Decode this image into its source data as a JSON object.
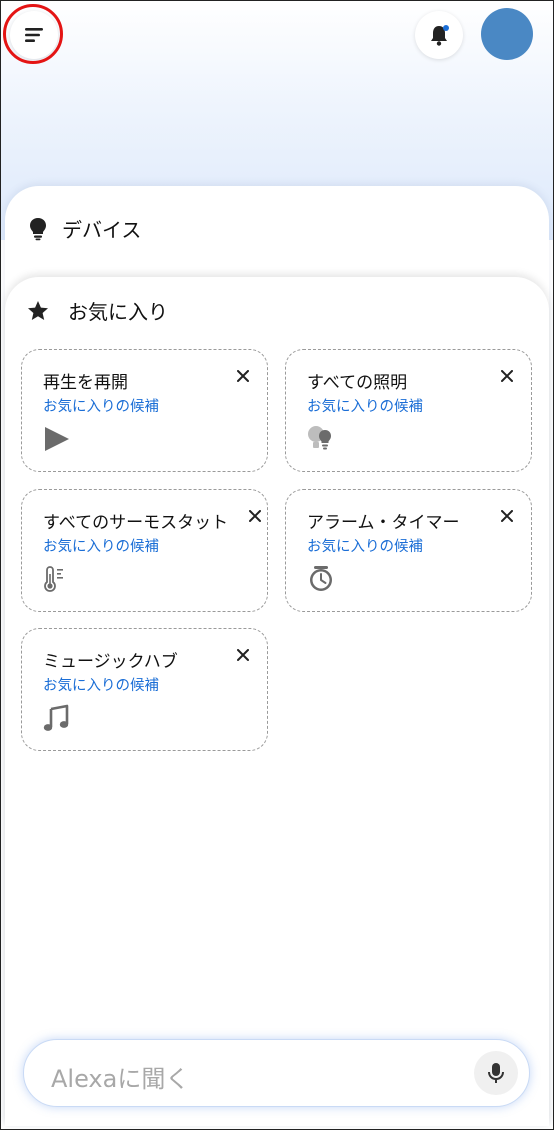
{
  "header": {
    "menu_icon": "menu-icon",
    "bell_icon": "bell-icon",
    "bell_dot_color": "#1b6ed6",
    "avatar_color": "#4a88c4"
  },
  "devices": {
    "label": "デバイス",
    "icon": "lightbulb-icon"
  },
  "favorites": {
    "label": "お気に入り",
    "icon": "star-icon",
    "cards": [
      {
        "title": "再生を再開",
        "subtitle": "お気に入りの候補",
        "icon": "play-icon"
      },
      {
        "title": "すべての照明",
        "subtitle": "お気に入りの候補",
        "icon": "lights-icon"
      },
      {
        "title": "すべてのサーモスタット",
        "subtitle": "お気に入りの候補",
        "icon": "thermometer-icon"
      },
      {
        "title": "アラーム・タイマー",
        "subtitle": "お気に入りの候補",
        "icon": "alarm-clock-icon"
      },
      {
        "title": "ミュージックハブ",
        "subtitle": "お気に入りの候補",
        "icon": "music-note-icon"
      }
    ]
  },
  "ask_bar": {
    "placeholder": "Alexaに聞く",
    "mic_icon": "microphone-icon"
  },
  "colors": {
    "accent": "#1b6ed6",
    "highlight_ring": "#e41414"
  }
}
